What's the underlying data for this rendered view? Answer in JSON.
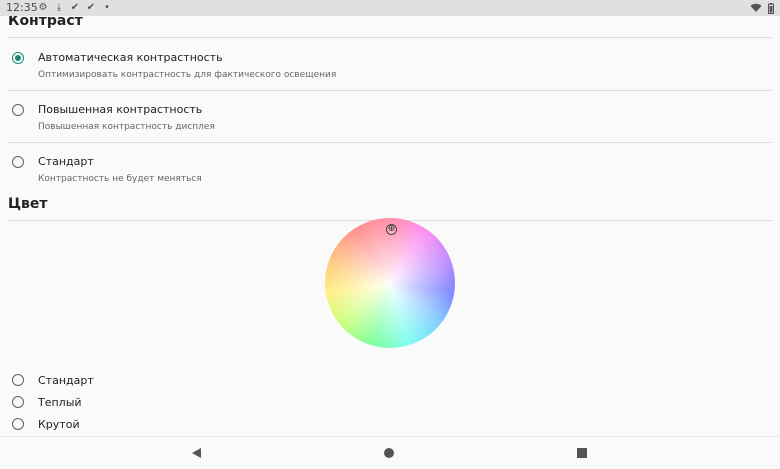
{
  "status_bar": {
    "time": "12:35",
    "icons": [
      "gear-icon",
      "download-icon",
      "check-icon",
      "check-icon",
      "dot-icon"
    ],
    "right_icons": [
      "wifi-icon",
      "battery-icon"
    ]
  },
  "contrast": {
    "title": "Контраст",
    "options": [
      {
        "label": "Автоматическая контрастность",
        "sub": "Оптимизировать контрастность для фактического освещения",
        "checked": true
      },
      {
        "label": "Повышенная контрастность",
        "sub": "Повышенная контрастность дисплея",
        "checked": false
      },
      {
        "label": "Стандарт",
        "sub": "Контрастность не будет меняться",
        "checked": false
      }
    ]
  },
  "color": {
    "title": "Цвет",
    "wheel_marker": "⊕",
    "options": [
      {
        "label": "Стандарт",
        "checked": false
      },
      {
        "label": "Теплый",
        "checked": false
      },
      {
        "label": "Крутой",
        "checked": false
      }
    ]
  },
  "nav": {
    "icons": [
      "back-icon",
      "home-icon",
      "recents-icon"
    ]
  },
  "colors": {
    "accent": "#1b8a72",
    "status_bar_bg": "#e0e0e0",
    "background": "#fafafa"
  }
}
